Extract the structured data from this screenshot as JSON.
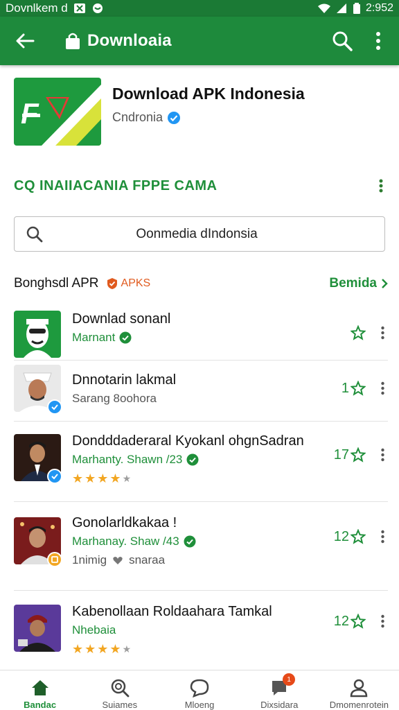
{
  "status_bar": {
    "left_text": "Dovnlkem d",
    "time": "2:952"
  },
  "app_bar": {
    "title": "Downloaia"
  },
  "app_header": {
    "name": "Download APK Indonesia",
    "developer": "Cndronia"
  },
  "banner": {
    "text": "CQ  INAIIACANIA FPPE CAMA"
  },
  "search": {
    "value": "Oonmedia dIndonsia"
  },
  "section": {
    "title": "Bonghsdl APR",
    "badge": "APKS",
    "more_label": "Bemida"
  },
  "list": [
    {
      "title": "Downlad sonanl",
      "subtitle": "Marnant",
      "rating": ""
    },
    {
      "title": "Dnnotarin lakmal",
      "subtitle": "Sarang  8oohora",
      "rating": "1"
    },
    {
      "title": "Dondddaderaral Kyokanl ohgnSadran",
      "subtitle": "Marhanty. Shawn /23",
      "rating": "17"
    },
    {
      "title": "Gonolarldkakaa !",
      "subtitle": "Marhanay. Shaw /43",
      "meta_left": "1nimig",
      "meta_right": "snaraa",
      "rating": "12"
    },
    {
      "title": "Kabenollaan Roldaahara Tamkal",
      "subtitle": "Nhebaia",
      "rating": "12"
    }
  ],
  "bottom_nav": [
    {
      "label": "Bandac"
    },
    {
      "label": "Suiames"
    },
    {
      "label": "Mloeng"
    },
    {
      "label": "Dixsidara",
      "badge": "1"
    },
    {
      "label": "Dmomenrotein"
    }
  ],
  "colors": {
    "brand_green": "#1e8a3c",
    "accent_green": "#1f8f3a",
    "star": "#f2a622",
    "verified_blue": "#2196f3"
  }
}
